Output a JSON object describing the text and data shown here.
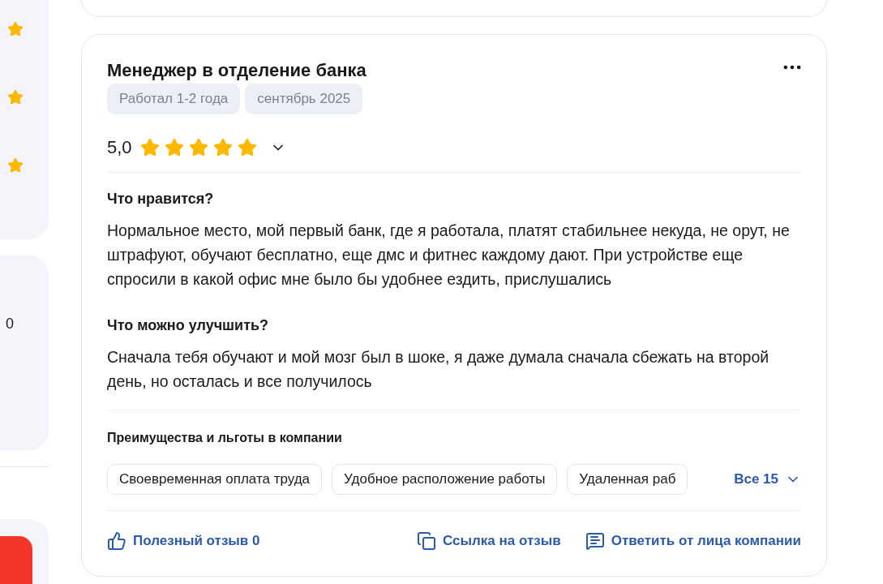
{
  "sidebar": {
    "amount": "0"
  },
  "review": {
    "title": "Менеджер в отделение банка",
    "tags": [
      "Работал 1-2 года",
      "сентябрь 2025"
    ],
    "rating": "5,0",
    "stars": 5,
    "expanded": false,
    "sections": [
      {
        "heading": "Что нравится?",
        "text": "Нормальное место, мой первый банк, где я работала, платят стабильнее некуда, не орут, не штрафуют, обучают бесплатно, еще дмс и фитнес каждому дают. При устройстве еще спросили в какой офис мне было бы удобнее ездить, прислушались"
      },
      {
        "heading": "Что можно улучшить?",
        "text": "Сначала тебя обучают и мой мозг был в шоке, я даже думала сначала сбежать на второй день, но осталась и все получилось"
      }
    ],
    "benefits_title": "Преимущества и льготы в компании",
    "benefits": [
      "Своевременная оплата труда",
      "Удобное расположение работы",
      "Удаленная раб"
    ],
    "benefits_more": "Все 15",
    "actions": [
      {
        "kind": "like",
        "label": "Полезный отзыв 0"
      },
      {
        "kind": "link",
        "label": "Ссылка на отзыв"
      },
      {
        "kind": "reply",
        "label": "Ответить от лица компании"
      }
    ]
  }
}
